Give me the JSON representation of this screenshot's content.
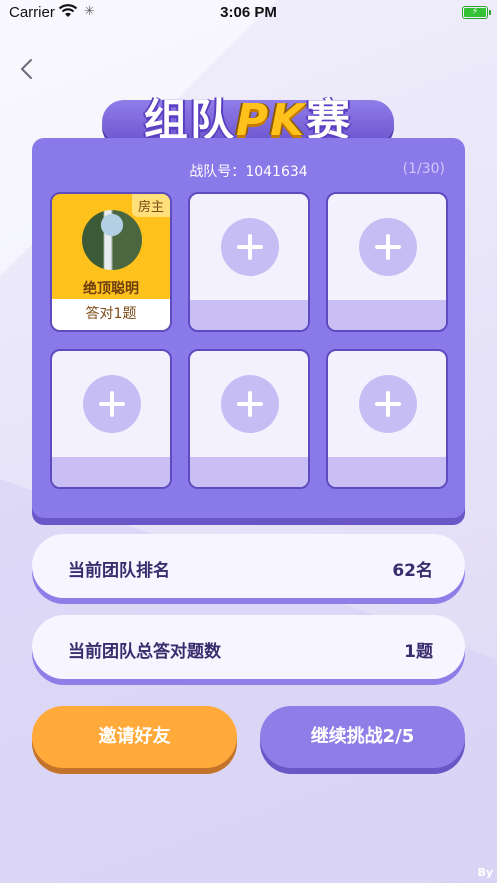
{
  "status_bar": {
    "carrier": "Carrier",
    "time": "3:06 PM"
  },
  "title": {
    "part1": "组队",
    "part2": "PK",
    "part3": "赛"
  },
  "team": {
    "label": "战队号：",
    "number": "1041634",
    "count": "(1/30)"
  },
  "host_slot": {
    "tag": "房主",
    "name": "绝顶聪明",
    "score": "答对1题"
  },
  "stats": {
    "rank_label": "当前团队排名",
    "rank_value": "62名",
    "correct_label": "当前团队总答对题数",
    "correct_value": "1题"
  },
  "buttons": {
    "invite": "邀请好友",
    "continue": "继续挑战2/5"
  },
  "watermark": "By",
  "colors": {
    "accent": "#8a79e8",
    "orange": "#ffaa3a",
    "host": "#ffc21c"
  }
}
